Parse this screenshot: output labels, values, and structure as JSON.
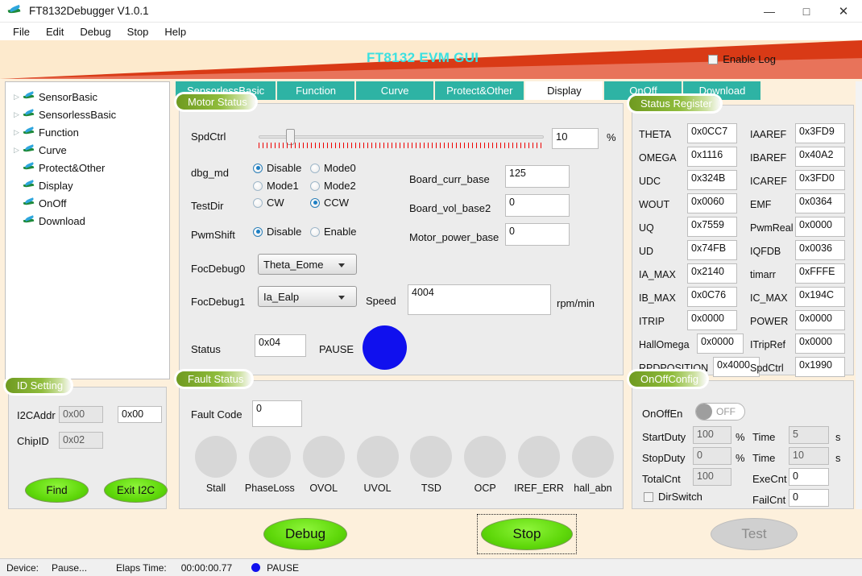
{
  "window": {
    "title": "FT8132Debugger V1.0.1",
    "minimize": "—",
    "maximize": "□",
    "close": "✕"
  },
  "menu": [
    "File",
    "Edit",
    "Debug",
    "Stop",
    "Help"
  ],
  "banner": {
    "title": "FT8132 EVM GUI",
    "enable_log_label": "Enable Log",
    "enable_log_checked": false
  },
  "tree": {
    "items": [
      {
        "label": "SensorBasic",
        "expandable": true
      },
      {
        "label": "SensorlessBasic",
        "expandable": true
      },
      {
        "label": "Function",
        "expandable": true
      },
      {
        "label": "Curve",
        "expandable": true
      },
      {
        "label": "Protect&Other",
        "expandable": false
      },
      {
        "label": "Display",
        "expandable": false
      },
      {
        "label": "OnOff",
        "expandable": false
      },
      {
        "label": "Download",
        "expandable": false
      }
    ]
  },
  "id_setting": {
    "title": "ID Setting",
    "i2caddr_label": "I2CAddr",
    "i2caddr_value": "0x00",
    "i2caddr_value2": "0x00",
    "chipid_label": "ChipID",
    "chipid_value": "0x02",
    "find_button": "Find",
    "exit_button": "Exit I2C"
  },
  "tabs": [
    {
      "label": "SensorlessBasic",
      "active": false
    },
    {
      "label": "Function",
      "active": false
    },
    {
      "label": "Curve",
      "active": false
    },
    {
      "label": "Protect&Other",
      "active": false
    },
    {
      "label": "Display",
      "active": true
    },
    {
      "label": "OnOff",
      "active": false
    },
    {
      "label": "Download",
      "active": false
    }
  ],
  "motor_status": {
    "title": "Motor Status",
    "spdctrl_label": "SpdCtrl",
    "spdctrl_value": "10",
    "spdctrl_unit": "%",
    "spdctrl_percent": 10,
    "dbg_md_label": "dbg_md",
    "dbg_md_options": [
      "Disable",
      "Mode0",
      "Mode1",
      "Mode2"
    ],
    "dbg_md_selected": "Disable",
    "testdir_label": "TestDir",
    "testdir_options": [
      "CW",
      "CCW"
    ],
    "testdir_selected": "CCW",
    "pwmshift_label": "PwmShift",
    "pwmshift_options": [
      "Disable",
      "Enable"
    ],
    "pwmshift_selected": "Disable",
    "board_curr_base_label": "Board_curr_base",
    "board_curr_base_value": "125",
    "board_vol_base2_label": "Board_vol_base2",
    "board_vol_base2_value": "0",
    "motor_power_base_label": "Motor_power_base",
    "motor_power_base_value": "0",
    "focdebug0_label": "FocDebug0",
    "focdebug0_value": "Theta_Eome",
    "focdebug1_label": "FocDebug1",
    "focdebug1_value": "Ia_Ealp",
    "speed_label": "Speed",
    "speed_value": "4004",
    "speed_unit": "rpm/min",
    "status_label": "Status",
    "status_value": "0x04",
    "status_text": "PAUSE",
    "status_lamp_color": "#1010ee"
  },
  "status_register": {
    "title": "Status Register",
    "left_column": [
      {
        "name": "THETA",
        "value": "0x0CC7"
      },
      {
        "name": "OMEGA",
        "value": "0x1116"
      },
      {
        "name": "UDC",
        "value": "0x324B"
      },
      {
        "name": "WOUT",
        "value": "0x0060"
      },
      {
        "name": "UQ",
        "value": "0x7559"
      },
      {
        "name": "UD",
        "value": "0x74FB"
      },
      {
        "name": "IA_MAX",
        "value": "0x2140"
      },
      {
        "name": "IB_MAX",
        "value": "0x0C76"
      },
      {
        "name": "ITRIP",
        "value": "0x0000"
      },
      {
        "name": "HallOmega",
        "value": "0x0000"
      },
      {
        "name": "RPDPOSITION",
        "value": "0x4000"
      }
    ],
    "right_column": [
      {
        "name": "IAAREF",
        "value": "0x3FD9"
      },
      {
        "name": "IBAREF",
        "value": "0x40A2"
      },
      {
        "name": "ICAREF",
        "value": "0x3FD0"
      },
      {
        "name": "EMF",
        "value": "0x0364"
      },
      {
        "name": "PwmReal",
        "value": "0x0000"
      },
      {
        "name": "IQFDB",
        "value": "0x0036"
      },
      {
        "name": "timarr",
        "value": "0xFFFE"
      },
      {
        "name": "IC_MAX",
        "value": "0x194C"
      },
      {
        "name": "POWER",
        "value": "0x0000"
      },
      {
        "name": "ITripRef",
        "value": "0x0000"
      },
      {
        "name": "SpdCtrl",
        "value": "0x1990"
      }
    ]
  },
  "fault_status": {
    "title": "Fault Status",
    "fault_code_label": "Fault Code",
    "fault_code_value": "0",
    "lamps": [
      "Stall",
      "PhaseLoss",
      "OVOL",
      "UVOL",
      "TSD",
      "OCP",
      "IREF_ERR",
      "hall_abn"
    ]
  },
  "onoff_config": {
    "title": "OnOffConfig",
    "onoffen_label": "OnOffEn",
    "onoffen_state": "OFF",
    "startduty_label": "StartDuty",
    "startduty_value": "100",
    "startduty_unit": "%",
    "starttime_label": "Time",
    "starttime_value": "5",
    "starttime_unit": "s",
    "stopduty_label": "StopDuty",
    "stopduty_value": "0",
    "stopduty_unit": "%",
    "stoptime_label": "Time",
    "stoptime_value": "10",
    "stoptime_unit": "s",
    "totalcnt_label": "TotalCnt",
    "totalcnt_value": "100",
    "execnt_label": "ExeCnt",
    "execnt_value": "0",
    "dirswitch_label": "DirSwitch",
    "dirswitch_checked": false,
    "failcnt_label": "FailCnt",
    "failcnt_value": "0"
  },
  "actions": {
    "debug_button": "Debug",
    "stop_button": "Stop",
    "test_button": "Test"
  },
  "statusbar": {
    "device_label": "Device:",
    "device_value": "Pause...",
    "elapsed_label": "Elaps Time:",
    "elapsed_value": "00:00:00.77",
    "state_text": "PAUSE"
  }
}
